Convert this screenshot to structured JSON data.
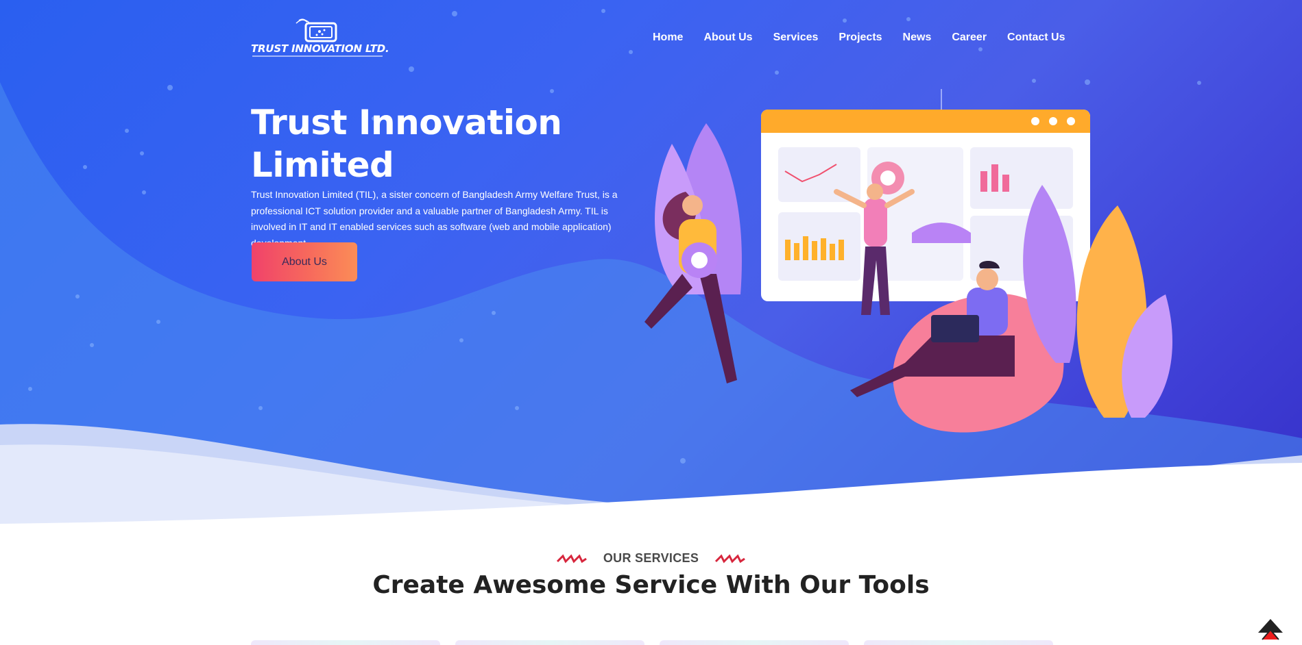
{
  "logo": {
    "text": "TRUST INNOVATION LTD.",
    "icon": "logo-mark-icon"
  },
  "nav": {
    "items": [
      {
        "label": "Home"
      },
      {
        "label": "About Us"
      },
      {
        "label": "Services"
      },
      {
        "label": "Projects"
      },
      {
        "label": "News"
      },
      {
        "label": "Career"
      },
      {
        "label": "Contact Us"
      }
    ]
  },
  "hero": {
    "title": "Trust Innovation Limited",
    "description": "Trust Innovation Limited (TIL), a sister concern of Bangladesh Army Welfare Trust, is a professional ICT solution provider and a valuable partner of Bangladesh Army. TIL is involved in IT and IT enabled services such as software (web and mobile application) development",
    "button_label": "About Us"
  },
  "services": {
    "subtitle": "OUR SERVICES",
    "title": "Create Awesome Service With Our Tools"
  },
  "back_to_top": {
    "icon": "arrow-up-icon"
  },
  "colors": {
    "hero_start": "#2a5ff0",
    "hero_end": "#3530c8",
    "button_start": "#f0426a",
    "button_end": "#fb8d57",
    "accent_red": "#d7263d"
  }
}
